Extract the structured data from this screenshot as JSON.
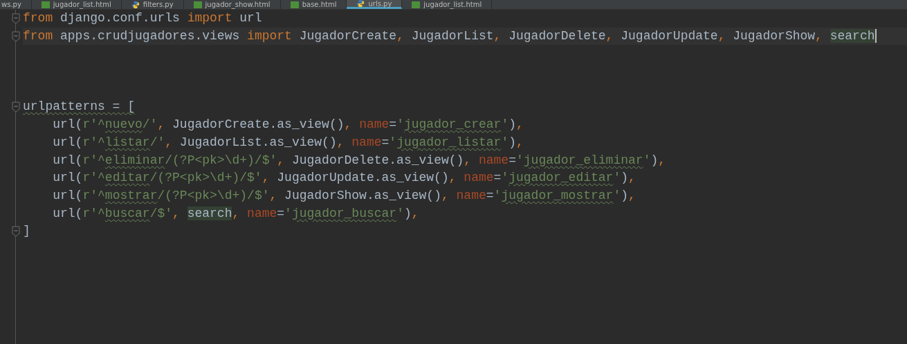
{
  "tabs": [
    {
      "label": "ws.py",
      "kind": "none",
      "selected": false
    },
    {
      "label": "jugador_list.html",
      "kind": "html",
      "selected": false
    },
    {
      "label": "filters.py",
      "kind": "py",
      "selected": false
    },
    {
      "label": "jugador_show.html",
      "kind": "html",
      "selected": false
    },
    {
      "label": "base.html",
      "kind": "html",
      "selected": false
    },
    {
      "label": "urls.py",
      "kind": "py",
      "selected": true
    },
    {
      "label": "jugador_list.html",
      "kind": "html",
      "selected": false
    }
  ],
  "lines": [
    {
      "fold": true,
      "cursor": false,
      "tokens": [
        {
          "text": "from",
          "kind": "kw"
        },
        {
          "text": " django.conf.urls ",
          "kind": "plain"
        },
        {
          "text": "import",
          "kind": "kw"
        },
        {
          "text": " url",
          "kind": "plain"
        }
      ]
    },
    {
      "fold": true,
      "cursor": true,
      "tokens": [
        {
          "text": "from",
          "kind": "kw"
        },
        {
          "text": " apps.crudjugadores.views ",
          "kind": "plain"
        },
        {
          "text": "import",
          "kind": "kw"
        },
        {
          "text": " JugadorCreate",
          "kind": "plain"
        },
        {
          "text": ",",
          "kind": "punct"
        },
        {
          "text": " JugadorList",
          "kind": "plain"
        },
        {
          "text": ",",
          "kind": "punct"
        },
        {
          "text": " JugadorDelete",
          "kind": "plain"
        },
        {
          "text": ",",
          "kind": "punct"
        },
        {
          "text": " JugadorUpdate",
          "kind": "plain"
        },
        {
          "text": ",",
          "kind": "punct"
        },
        {
          "text": " JugadorShow",
          "kind": "plain"
        },
        {
          "text": ", ",
          "kind": "punct"
        },
        {
          "text": "search",
          "kind": "ref"
        }
      ]
    },
    {
      "fold": false,
      "cursor": false
    },
    {
      "fold": false,
      "cursor": false
    },
    {
      "fold": false,
      "cursor": false
    },
    {
      "fold": true,
      "cursor": false,
      "tokens": [
        {
          "text": "urlpatterns = [",
          "kind": "warnvar"
        }
      ]
    },
    {
      "fold": false,
      "cursor": false,
      "tokens": [
        {
          "text": "    url(",
          "kind": "plain"
        },
        {
          "text": "r'^",
          "kind": "str"
        },
        {
          "text": "nuevo",
          "kind": "typo"
        },
        {
          "text": "/'",
          "kind": "str"
        },
        {
          "text": ",",
          "kind": "punct"
        },
        {
          "text": " JugadorCreate.as_view()",
          "kind": "plain"
        },
        {
          "text": ", ",
          "kind": "punct"
        },
        {
          "text": "name",
          "kind": "param"
        },
        {
          "text": "=",
          "kind": "plain"
        },
        {
          "text": "'",
          "kind": "str"
        },
        {
          "text": "jugador_crear",
          "kind": "typo"
        },
        {
          "text": "'",
          "kind": "str"
        },
        {
          "text": ")",
          "kind": "plain"
        },
        {
          "text": ",",
          "kind": "punct"
        }
      ]
    },
    {
      "fold": false,
      "cursor": false,
      "tokens": [
        {
          "text": "    url(",
          "kind": "plain"
        },
        {
          "text": "r'^",
          "kind": "str"
        },
        {
          "text": "listar",
          "kind": "typo"
        },
        {
          "text": "/'",
          "kind": "str"
        },
        {
          "text": ",",
          "kind": "punct"
        },
        {
          "text": " JugadorList.as_view()",
          "kind": "plain"
        },
        {
          "text": ", ",
          "kind": "punct"
        },
        {
          "text": "name",
          "kind": "param"
        },
        {
          "text": "=",
          "kind": "plain"
        },
        {
          "text": "'",
          "kind": "str"
        },
        {
          "text": "jugador_listar",
          "kind": "typo"
        },
        {
          "text": "'",
          "kind": "str"
        },
        {
          "text": ")",
          "kind": "plain"
        },
        {
          "text": ",",
          "kind": "punct"
        }
      ]
    },
    {
      "fold": false,
      "cursor": false,
      "tokens": [
        {
          "text": "    url(",
          "kind": "plain"
        },
        {
          "text": "r'^",
          "kind": "str"
        },
        {
          "text": "eliminar",
          "kind": "typo"
        },
        {
          "text": "/(?P<pk>\\d+)/$'",
          "kind": "str"
        },
        {
          "text": ",",
          "kind": "punct"
        },
        {
          "text": " JugadorDelete.as_view()",
          "kind": "plain"
        },
        {
          "text": ", ",
          "kind": "punct"
        },
        {
          "text": "name",
          "kind": "param"
        },
        {
          "text": "=",
          "kind": "plain"
        },
        {
          "text": "'",
          "kind": "str"
        },
        {
          "text": "jugador_eliminar",
          "kind": "typo"
        },
        {
          "text": "'",
          "kind": "str"
        },
        {
          "text": ")",
          "kind": "plain"
        },
        {
          "text": ",",
          "kind": "punct"
        }
      ]
    },
    {
      "fold": false,
      "cursor": false,
      "tokens": [
        {
          "text": "    url(",
          "kind": "plain"
        },
        {
          "text": "r'^",
          "kind": "str"
        },
        {
          "text": "editar",
          "kind": "typo"
        },
        {
          "text": "/(?P<pk>\\d+)/$'",
          "kind": "str"
        },
        {
          "text": ",",
          "kind": "punct"
        },
        {
          "text": " JugadorUpdate.as_view()",
          "kind": "plain"
        },
        {
          "text": ", ",
          "kind": "punct"
        },
        {
          "text": "name",
          "kind": "param"
        },
        {
          "text": "=",
          "kind": "plain"
        },
        {
          "text": "'",
          "kind": "str"
        },
        {
          "text": "jugador_editar",
          "kind": "typo"
        },
        {
          "text": "'",
          "kind": "str"
        },
        {
          "text": ")",
          "kind": "plain"
        },
        {
          "text": ",",
          "kind": "punct"
        }
      ]
    },
    {
      "fold": false,
      "cursor": false,
      "tokens": [
        {
          "text": "    url(",
          "kind": "plain"
        },
        {
          "text": "r'^",
          "kind": "str"
        },
        {
          "text": "mostrar",
          "kind": "typo"
        },
        {
          "text": "/(?P<pk>\\d+)/$'",
          "kind": "str"
        },
        {
          "text": ",",
          "kind": "punct"
        },
        {
          "text": " JugadorShow.as_view()",
          "kind": "plain"
        },
        {
          "text": ", ",
          "kind": "punct"
        },
        {
          "text": "name",
          "kind": "param"
        },
        {
          "text": "=",
          "kind": "plain"
        },
        {
          "text": "'",
          "kind": "str"
        },
        {
          "text": "jugador_mostrar",
          "kind": "typo"
        },
        {
          "text": "'",
          "kind": "str"
        },
        {
          "text": ")",
          "kind": "plain"
        },
        {
          "text": ",",
          "kind": "punct"
        }
      ]
    },
    {
      "fold": false,
      "cursor": false,
      "tokens": [
        {
          "text": "    url(",
          "kind": "plain"
        },
        {
          "text": "r'^",
          "kind": "str"
        },
        {
          "text": "buscar",
          "kind": "typo"
        },
        {
          "text": "/$'",
          "kind": "str"
        },
        {
          "text": ", ",
          "kind": "punct"
        },
        {
          "text": "search",
          "kind": "ref"
        },
        {
          "text": ", ",
          "kind": "punct"
        },
        {
          "text": "name",
          "kind": "param"
        },
        {
          "text": "=",
          "kind": "plain"
        },
        {
          "text": "'",
          "kind": "str"
        },
        {
          "text": "jugador_buscar",
          "kind": "typo"
        },
        {
          "text": "'",
          "kind": "str"
        },
        {
          "text": ")",
          "kind": "plain"
        },
        {
          "text": ",",
          "kind": "punct"
        }
      ]
    },
    {
      "fold": true,
      "cursor": false,
      "tokens": [
        {
          "text": "]",
          "kind": "plain"
        }
      ]
    }
  ]
}
